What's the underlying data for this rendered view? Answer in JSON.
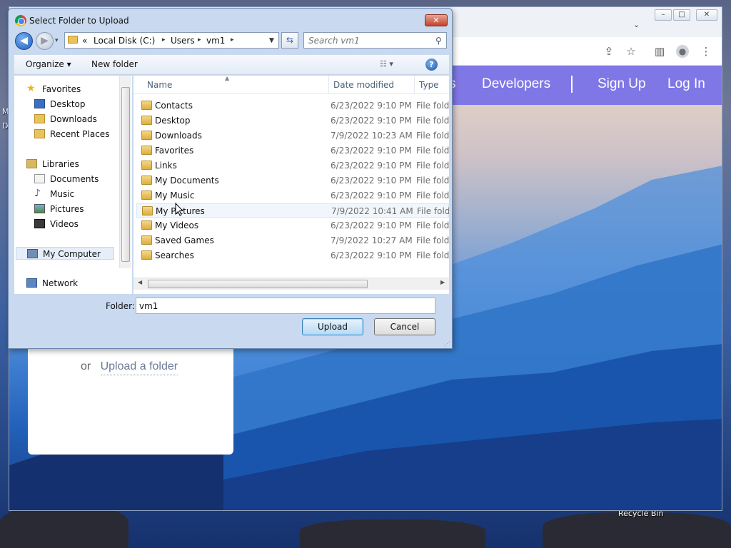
{
  "desktop": {
    "recycle_bin_label": "Recycle Bin",
    "left_fragment_1": "M",
    "left_fragment_2": "D"
  },
  "browser": {
    "controls": {
      "minimize": "–",
      "maximize": "□",
      "close": "✕"
    },
    "tab_dropdown": "⌄",
    "toolbar_icons": [
      "share-icon",
      "star-icon",
      "side-panel-icon",
      "profile-icon",
      "menu-icon"
    ]
  },
  "site": {
    "nav": {
      "partial": "s",
      "developers": "Developers",
      "sign_up": "Sign Up",
      "log_in": "Log In"
    },
    "card": {
      "or_text": "or",
      "upload_folder_link": "Upload a folder"
    },
    "nav_bg_color": "#7f77e6"
  },
  "dialog": {
    "title": "Select Folder to Upload",
    "close_label": "✕",
    "address": {
      "history_glyph": "▾",
      "overflow": "«",
      "crumbs": [
        "Local Disk (C:)",
        "Users",
        "vm1"
      ]
    },
    "search_placeholder": "Search vm1",
    "toolbar": {
      "organize": "Organize ▾",
      "new_folder": "New folder",
      "view": "☷ ▾",
      "help": "?"
    },
    "nav": {
      "favorites": "Favorites",
      "desktop": "Desktop",
      "downloads": "Downloads",
      "recent_places": "Recent Places",
      "libraries": "Libraries",
      "documents": "Documents",
      "music": "Music",
      "pictures": "Pictures",
      "videos": "Videos",
      "my_computer": "My Computer",
      "network": "Network"
    },
    "columns": {
      "name": "Name",
      "date_modified": "Date modified",
      "type": "Type"
    },
    "files": [
      {
        "name": "Contacts",
        "date": "6/23/2022 9:10 PM",
        "type": "File folder"
      },
      {
        "name": "Desktop",
        "date": "6/23/2022 9:10 PM",
        "type": "File folder"
      },
      {
        "name": "Downloads",
        "date": "7/9/2022 10:23 AM",
        "type": "File folder"
      },
      {
        "name": "Favorites",
        "date": "6/23/2022 9:10 PM",
        "type": "File folder"
      },
      {
        "name": "Links",
        "date": "6/23/2022 9:10 PM",
        "type": "File folder"
      },
      {
        "name": "My Documents",
        "date": "6/23/2022 9:10 PM",
        "type": "File folder"
      },
      {
        "name": "My Music",
        "date": "6/23/2022 9:10 PM",
        "type": "File folder"
      },
      {
        "name": "My Pictures",
        "date": "7/9/2022 10:41 AM",
        "type": "File folder"
      },
      {
        "name": "My Videos",
        "date": "6/23/2022 9:10 PM",
        "type": "File folder"
      },
      {
        "name": "Saved Games",
        "date": "7/9/2022 10:27 AM",
        "type": "File folder"
      },
      {
        "name": "Searches",
        "date": "6/23/2022 9:10 PM",
        "type": "File folder"
      }
    ],
    "folder_label": "Folder:",
    "folder_value": "vm1",
    "upload_button": "Upload",
    "cancel_button": "Cancel"
  }
}
